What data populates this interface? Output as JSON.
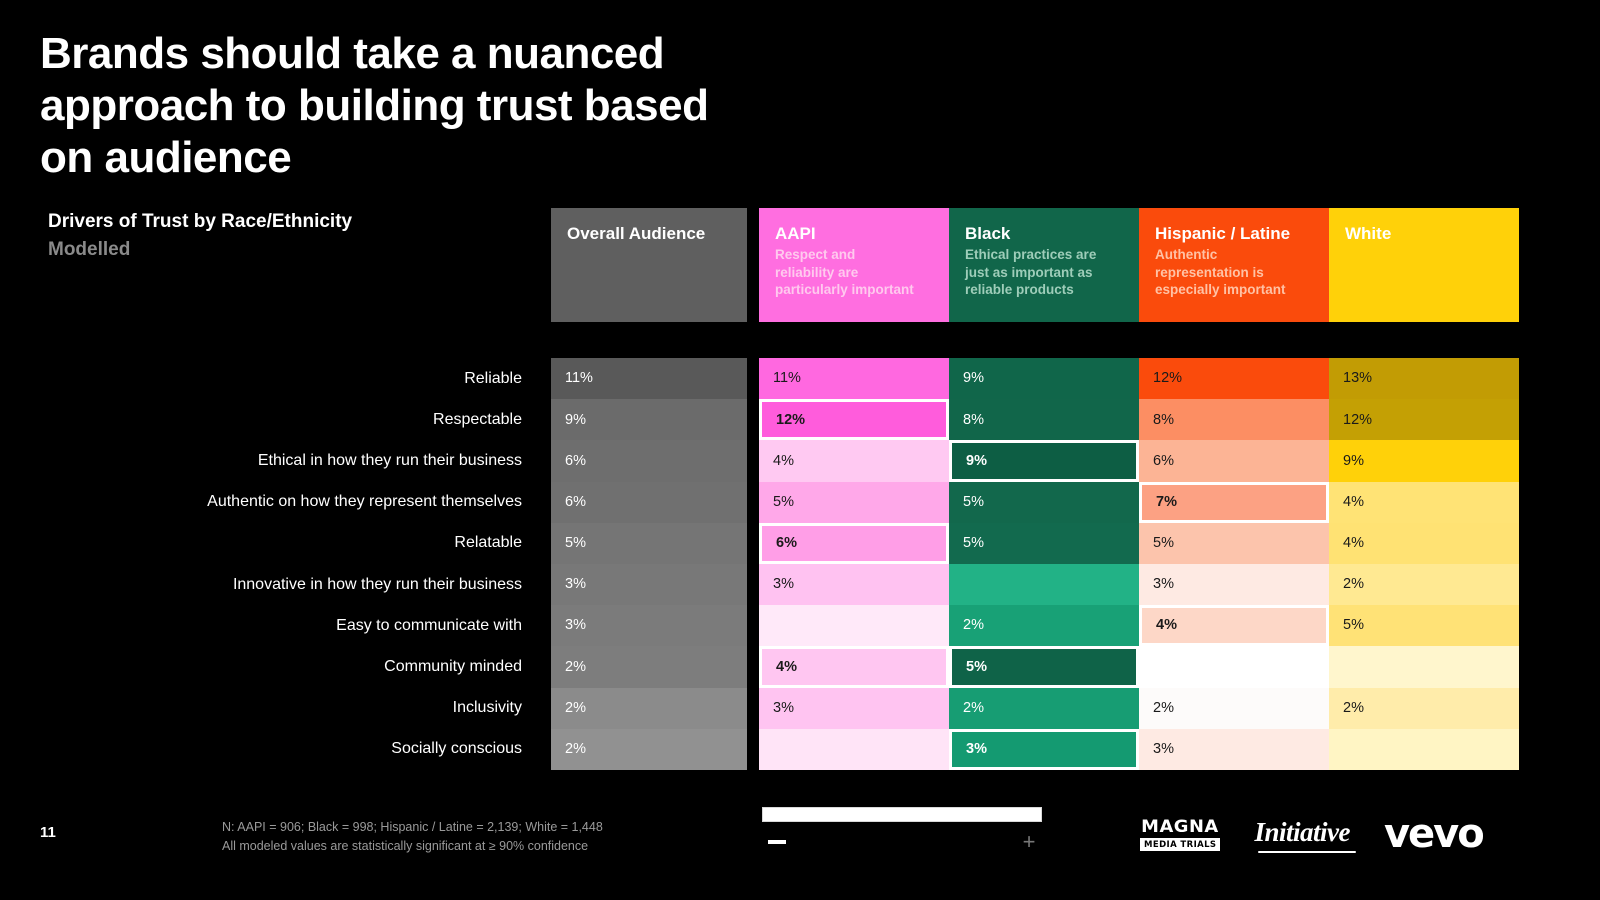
{
  "slide": {
    "title": "Brands should take a nuanced\napproach to building trust based\non audience",
    "subtitle_main": "Drivers of Trust by Race/Ethnicity",
    "subtitle_sub": "Modelled",
    "page_number": "11",
    "footnote_line1": "N: AAPI = 906; Black = 998; Hispanic / Latine = 2,139; White = 1,448",
    "footnote_line2": "All modeled values are statistically significant at ≥ 90% confidence",
    "footnotes": "N: AAPI = 906; Black = 998; Hispanic / Latine = 2,139; White = 1,448\nAll modeled values are statistically significant at ≥ 90% confidence"
  },
  "columns": [
    {
      "key": "overall",
      "title": "Overall Audience",
      "subtitle": "",
      "header_bg": "#5f5f5f",
      "accent": "#5f5f5f"
    },
    {
      "key": "aapi",
      "title": "AAPI",
      "subtitle": "Respect and\nreliability are\nparticularly important",
      "header_bg": "#ff6ee0",
      "accent": "#ff6ee0"
    },
    {
      "key": "black",
      "title": "Black",
      "subtitle": "Ethical practices are\njust as important as\nreliable products",
      "header_bg": "#11664a",
      "accent": "#11664a"
    },
    {
      "key": "hispanic",
      "title": "Hispanic / Latine",
      "subtitle": "Authentic\nrepresentation is\nespecially important",
      "header_bg": "#fa4b0c",
      "accent": "#fa4b0c"
    },
    {
      "key": "white",
      "title": "White",
      "subtitle": "",
      "header_bg": "#ffd109",
      "accent": "#ffd109"
    }
  ],
  "rows": [
    "Reliable",
    "Respectable",
    "Ethical in how they run their business",
    "Authentic on how they represent themselves",
    "Relatable",
    "Innovative in how they run their business",
    "Easy to communicate with",
    "Community minded",
    "Inclusivity",
    "Socially conscious"
  ],
  "chart_data": {
    "type": "heatmap",
    "title": "Drivers of Trust by Race/Ethnicity",
    "subtitle": "Modelled",
    "xlabel": "",
    "ylabel": "",
    "legend_position": "top",
    "grid": false,
    "unit": "%",
    "categories": [
      "Reliable",
      "Respectable",
      "Ethical in how they run their business",
      "Authentic on how they represent themselves",
      "Relatable",
      "Innovative in how they run their business",
      "Easy to communicate with",
      "Community minded",
      "Inclusivity",
      "Socially conscious"
    ],
    "series": [
      {
        "name": "Overall Audience",
        "values": [
          11,
          9,
          6,
          6,
          5,
          3,
          3,
          2,
          2,
          2
        ]
      },
      {
        "name": "AAPI",
        "values": [
          11,
          12,
          4,
          5,
          6,
          3,
          null,
          4,
          3,
          null
        ]
      },
      {
        "name": "Black",
        "values": [
          9,
          8,
          9,
          5,
          5,
          null,
          2,
          5,
          2,
          3
        ]
      },
      {
        "name": "Hispanic / Latine",
        "values": [
          12,
          8,
          6,
          7,
          5,
          3,
          4,
          null,
          2,
          3
        ]
      },
      {
        "name": "White",
        "values": [
          13,
          12,
          9,
          4,
          4,
          2,
          5,
          null,
          2,
          null
        ]
      }
    ],
    "highlighted": [
      {
        "series": "AAPI",
        "category": "Respectable",
        "value": 12
      },
      {
        "series": "AAPI",
        "category": "Relatable",
        "value": 6
      },
      {
        "series": "AAPI",
        "category": "Community minded",
        "value": 4
      },
      {
        "series": "Black",
        "category": "Ethical in how they run their business",
        "value": 9
      },
      {
        "series": "Black",
        "category": "Community minded",
        "value": 5
      },
      {
        "series": "Black",
        "category": "Socially conscious",
        "value": 3
      },
      {
        "series": "Hispanic / Latine",
        "category": "Authentic on how they represent themselves",
        "value": 7
      },
      {
        "series": "Hispanic / Latine",
        "category": "Easy to communicate with",
        "value": 4
      }
    ]
  },
  "cells": {
    "overall": [
      {
        "label": "11%",
        "bg": "#595959",
        "dark": false,
        "hl": false
      },
      {
        "label": "9%",
        "bg": "#6b6b6b",
        "dark": false,
        "hl": false
      },
      {
        "label": "6%",
        "bg": "#6e6e6e",
        "dark": false,
        "hl": false
      },
      {
        "label": "6%",
        "bg": "#707070",
        "dark": false,
        "hl": false
      },
      {
        "label": "5%",
        "bg": "#757575",
        "dark": false,
        "hl": false
      },
      {
        "label": "3%",
        "bg": "#787878",
        "dark": false,
        "hl": false
      },
      {
        "label": "3%",
        "bg": "#7b7b7b",
        "dark": false,
        "hl": false
      },
      {
        "label": "2%",
        "bg": "#7d7d7d",
        "dark": false,
        "hl": false
      },
      {
        "label": "2%",
        "bg": "#8b8b8b",
        "dark": false,
        "hl": false
      },
      {
        "label": "2%",
        "bg": "#919191",
        "dark": false,
        "hl": false
      }
    ],
    "aapi": [
      {
        "label": "11%",
        "bg": "#ff68e0",
        "dark": true,
        "hl": false
      },
      {
        "label": "12%",
        "bg": "#ff5cdc",
        "dark": true,
        "hl": true
      },
      {
        "label": "4%",
        "bg": "#ffc9f2",
        "dark": true,
        "hl": false
      },
      {
        "label": "5%",
        "bg": "#ffa8e9",
        "dark": true,
        "hl": false
      },
      {
        "label": "6%",
        "bg": "#ff9ee7",
        "dark": true,
        "hl": true
      },
      {
        "label": "3%",
        "bg": "#ffc2f1",
        "dark": true,
        "hl": false
      },
      {
        "label": "",
        "bg": "#ffe9f9",
        "dark": true,
        "hl": false
      },
      {
        "label": "4%",
        "bg": "#ffc6f1",
        "dark": true,
        "hl": true
      },
      {
        "label": "3%",
        "bg": "#ffc4f1",
        "dark": true,
        "hl": false
      },
      {
        "label": "",
        "bg": "#ffe4f7",
        "dark": true,
        "hl": false
      }
    ],
    "black": [
      {
        "label": "9%",
        "bg": "#10664a",
        "dark": false,
        "hl": false
      },
      {
        "label": "8%",
        "bg": "#11664a",
        "dark": false,
        "hl": false
      },
      {
        "label": "9%",
        "bg": "#0d5e44",
        "dark": false,
        "hl": true
      },
      {
        "label": "5%",
        "bg": "#12684c",
        "dark": false,
        "hl": false
      },
      {
        "label": "5%",
        "bg": "#126a4e",
        "dark": false,
        "hl": false
      },
      {
        "label": "",
        "bg": "#22b286",
        "dark": false,
        "hl": false
      },
      {
        "label": "2%",
        "bg": "#18a176",
        "dark": false,
        "hl": false
      },
      {
        "label": "5%",
        "bg": "#0f6348",
        "dark": false,
        "hl": true
      },
      {
        "label": "2%",
        "bg": "#179d73",
        "dark": false,
        "hl": false
      },
      {
        "label": "3%",
        "bg": "#149a71",
        "dark": false,
        "hl": true
      }
    ],
    "hispanic": [
      {
        "label": "12%",
        "bg": "#fa4b0c",
        "dark": true,
        "hl": false
      },
      {
        "label": "8%",
        "bg": "#fc8e63",
        "dark": true,
        "hl": false
      },
      {
        "label": "6%",
        "bg": "#fcb495",
        "dark": true,
        "hl": false
      },
      {
        "label": "7%",
        "bg": "#fca183",
        "dark": true,
        "hl": true
      },
      {
        "label": "5%",
        "bg": "#fcc4ac",
        "dark": true,
        "hl": false
      },
      {
        "label": "3%",
        "bg": "#feeae3",
        "dark": true,
        "hl": false
      },
      {
        "label": "4%",
        "bg": "#fdd7c7",
        "dark": true,
        "hl": true
      },
      {
        "label": "",
        "bg": "#ffffff",
        "dark": true,
        "hl": false
      },
      {
        "label": "2%",
        "bg": "#fdfbfa",
        "dark": true,
        "hl": false
      },
      {
        "label": "3%",
        "bg": "#feeae3",
        "dark": true,
        "hl": false
      }
    ],
    "white": [
      {
        "label": "13%",
        "bg": "#c29c04",
        "dark": true,
        "hl": false
      },
      {
        "label": "12%",
        "bg": "#c4a004",
        "dark": true,
        "hl": false
      },
      {
        "label": "9%",
        "bg": "#ffd109",
        "dark": true,
        "hl": false
      },
      {
        "label": "4%",
        "bg": "#ffe375",
        "dark": true,
        "hl": false
      },
      {
        "label": "4%",
        "bg": "#ffe273",
        "dark": true,
        "hl": false
      },
      {
        "label": "2%",
        "bg": "#ffe992",
        "dark": true,
        "hl": false
      },
      {
        "label": "5%",
        "bg": "#ffe276",
        "dark": true,
        "hl": false
      },
      {
        "label": "",
        "bg": "#fff6cd",
        "dark": true,
        "hl": false
      },
      {
        "label": "2%",
        "bg": "#ffecaa",
        "dark": true,
        "hl": false
      },
      {
        "label": "",
        "bg": "#fff5c4",
        "dark": true,
        "hl": false
      }
    ]
  },
  "footer_controls": {
    "zoom_out_label": "−",
    "zoom_in_label": "+"
  },
  "logos": {
    "magna_top": "MAGNA",
    "magna_bottom": "MEDIA TRIALS",
    "initiative": "Initiative",
    "vevo": "vevo"
  }
}
